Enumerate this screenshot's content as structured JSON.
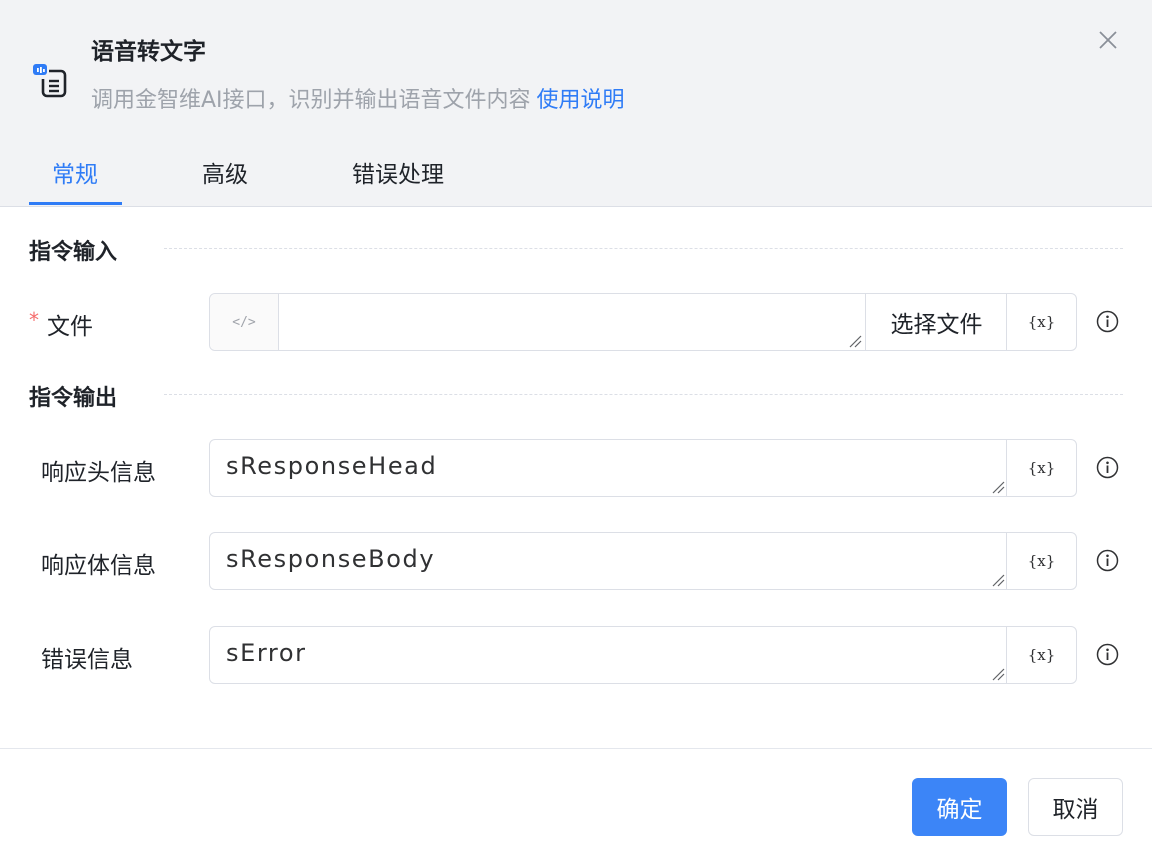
{
  "dialog": {
    "title": "语音转文字",
    "subtitle": "调用金智维AI接口，识别并输出语音文件内容",
    "help_link": "使用说明"
  },
  "tabs": [
    {
      "label": "常规",
      "active": true
    },
    {
      "label": "高级",
      "active": false
    },
    {
      "label": "错误处理",
      "active": false
    }
  ],
  "sections": {
    "input_title": "指令输入",
    "output_title": "指令输出"
  },
  "input_fields": {
    "file": {
      "required_mark": "*",
      "label": "文件",
      "value": "",
      "code_icon": "</>",
      "select_button": "选择文件",
      "var_button": "{x}"
    }
  },
  "output_fields": [
    {
      "label": "响应头信息",
      "value": "sResponseHead",
      "var_button": "{x}"
    },
    {
      "label": "响应体信息",
      "value": "sResponseBody",
      "var_button": "{x}"
    },
    {
      "label": "错误信息",
      "value": "sError",
      "var_button": "{x}"
    }
  ],
  "footer": {
    "confirm_label": "确定",
    "cancel_label": "取消"
  },
  "colors": {
    "accent": "#2f7cf6",
    "header_bg": "#f2f3f5",
    "required": "#f56c6c"
  },
  "icons": [
    "speech-doc-icon",
    "close-icon",
    "code-icon",
    "variable-icon",
    "info-icon",
    "resize-handle-icon"
  ]
}
